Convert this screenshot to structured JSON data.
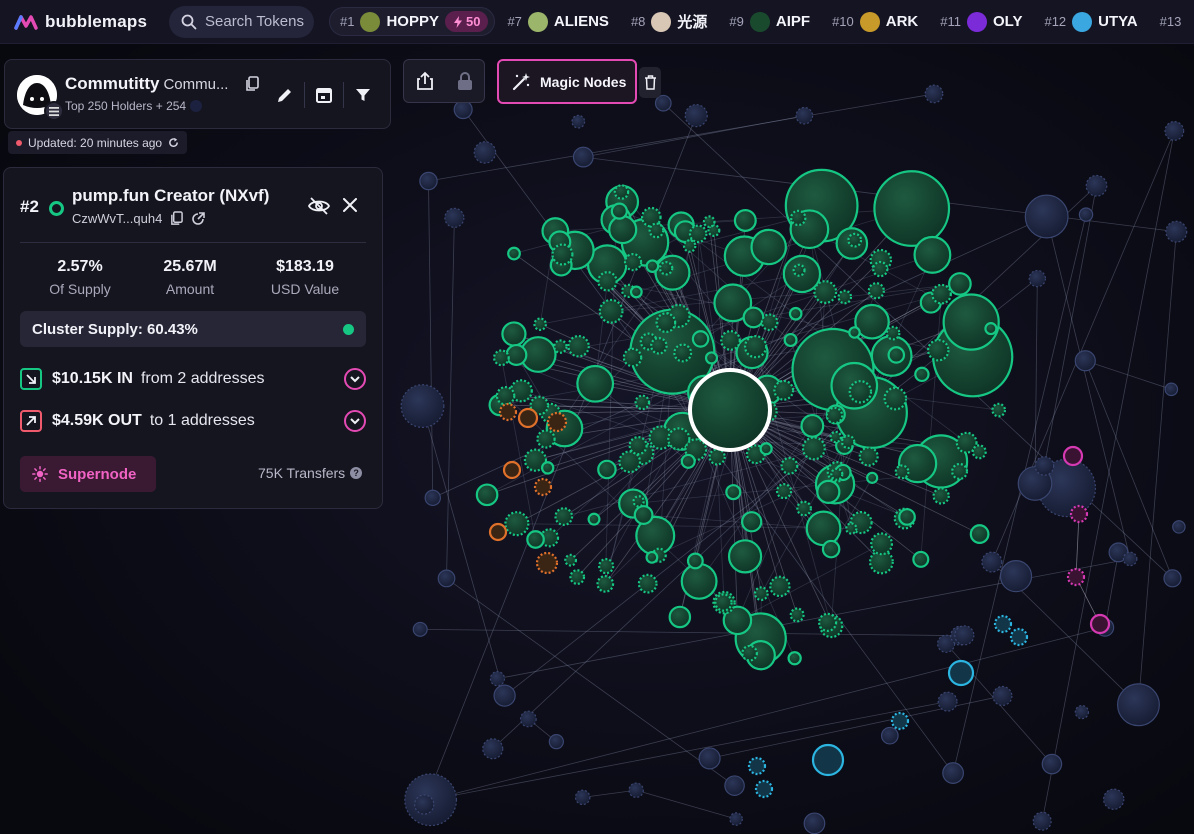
{
  "app": {
    "name": "bubblemaps"
  },
  "search": {
    "placeholder": "Search Tokens"
  },
  "ticker": [
    {
      "rank": "#1",
      "name": "HOPPY",
      "boost": "50",
      "color": "#7a8b3a"
    },
    {
      "rank": "#7",
      "name": "ALIENS",
      "color": "#9bb56a"
    },
    {
      "rank": "#8",
      "name": "光源",
      "color": "#d9c7b5"
    },
    {
      "rank": "#9",
      "name": "AIPF",
      "color": "#1a4a2e"
    },
    {
      "rank": "#10",
      "name": "ARK",
      "color": "#c89a2a"
    },
    {
      "rank": "#11",
      "name": "OLY",
      "color": "#7c2bd9"
    },
    {
      "rank": "#12",
      "name": "UTYA",
      "color": "#3aa7e0"
    },
    {
      "rank": "#13",
      "name": "",
      "color": "#555"
    }
  ],
  "token": {
    "name": "Commutitty",
    "symbol": "Commu...",
    "subtitle": "Top 250 Holders + 254",
    "updated": "Updated: 20 minutes ago"
  },
  "toolbar": {
    "magic_label": "Magic Nodes"
  },
  "detail": {
    "rank": "#2",
    "title": "pump.fun Creator (NXvf)",
    "address": "CzwWvT...quh4",
    "stats": [
      {
        "value": "2.57%",
        "label": "Of Supply"
      },
      {
        "value": "25.67M",
        "label": "Amount"
      },
      {
        "value": "$183.19",
        "label": "USD Value"
      }
    ],
    "cluster_supply": "Cluster Supply: 60.43%",
    "flow_in": {
      "amount": "$10.15K IN",
      "from": "from 2 addresses"
    },
    "flow_out": {
      "amount": "$4.59K OUT",
      "from": "to 1 addresses"
    },
    "supernode_label": "Supernode",
    "transfers": "75K Transfers"
  },
  "colors": {
    "accent": "#e34ab3",
    "cluster_green": "#16c784",
    "node_blue": "#24304f",
    "node_orange": "#e0712b",
    "node_cyan": "#2bb5e0",
    "node_magenta": "#d63ab3"
  }
}
